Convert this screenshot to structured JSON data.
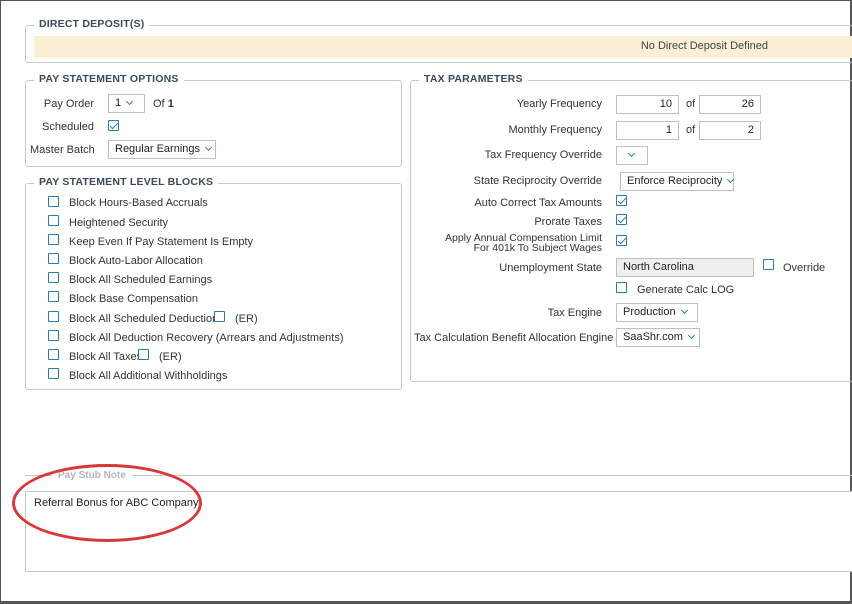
{
  "direct_deposits": {
    "legend": "DIRECT DEPOSIT(S)",
    "empty_message": "No Direct Deposit Defined"
  },
  "pay_statement_options": {
    "legend": "PAY STATEMENT OPTIONS",
    "pay_order_label": "Pay Order",
    "pay_order_value": "1",
    "of_text": "Of",
    "of_total": "1",
    "scheduled_label": "Scheduled",
    "scheduled_checked": true,
    "master_batch_label": "Master Batch",
    "master_batch_value": "Regular Earnings"
  },
  "level_blocks": {
    "legend": "PAY STATEMENT LEVEL BLOCKS",
    "items": [
      {
        "label": "Block Hours-Based Accruals"
      },
      {
        "label": "Heightened Security"
      },
      {
        "label": "Keep Even If Pay Statement Is Empty"
      },
      {
        "label": "Block Auto-Labor Allocation"
      },
      {
        "label": "Block All Scheduled Earnings"
      },
      {
        "label": "Block Base Compensation"
      },
      {
        "label": "Block All Scheduled Deductions",
        "er_label": "(ER)"
      },
      {
        "label": "Block All Deduction Recovery (Arrears and Adjustments)"
      },
      {
        "label": "Block All Taxes",
        "er_label": "(ER)"
      },
      {
        "label": "Block All Additional Withholdings"
      }
    ]
  },
  "tax_parameters": {
    "legend": "TAX PARAMETERS",
    "yearly_frequency_label": "Yearly Frequency",
    "yearly_frequency_value": "10",
    "yearly_of": "of",
    "yearly_total": "26",
    "monthly_frequency_label": "Monthly Frequency",
    "monthly_frequency_value": "1",
    "monthly_of": "of",
    "monthly_total": "2",
    "tax_frequency_override_label": "Tax Frequency Override",
    "tax_frequency_override_value": "",
    "state_reciprocity_override_label": "State Reciprocity Override",
    "state_reciprocity_override_value": "Enforce Reciprocity",
    "auto_correct_label": "Auto Correct Tax Amounts",
    "auto_correct_checked": true,
    "prorate_label": "Prorate Taxes",
    "prorate_checked": true,
    "annual_limit_label_line1": "Apply Annual Compensation Limit",
    "annual_limit_label_line2": "For 401k To Subject Wages",
    "annual_limit_checked": true,
    "unemployment_state_label": "Unemployment State",
    "unemployment_state_value": "North Carolina",
    "override_label": "Override",
    "override_checked": false,
    "generate_calc_log_label": "Generate Calc LOG",
    "generate_calc_log_checked": false,
    "tax_engine_label": "Tax Engine",
    "tax_engine_value": "Production",
    "benefit_allocation_engine_label": "Tax Calculation Benefit Allocation Engine",
    "benefit_allocation_engine_value": "SaaShr.com"
  },
  "pay_stub_note": {
    "legend": "Pay Stub Note",
    "text": "Referral Bonus for ABC Company!"
  },
  "colors": {
    "accent": "#2a7ab8",
    "banner_bg": "#fbefd6",
    "highlight_oval": "#d9383a"
  }
}
